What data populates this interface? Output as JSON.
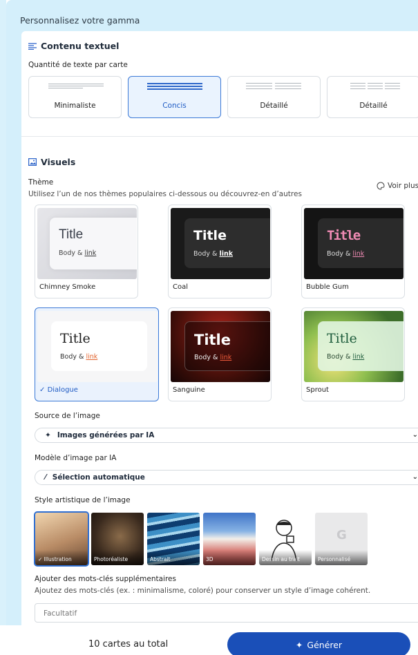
{
  "header": {
    "title": "Personnalisez votre gamma"
  },
  "text_section": {
    "title": "Contenu textuel",
    "quantity_label": "Quantité de texte par carte",
    "options": [
      {
        "label": "Minimaliste",
        "selected": false
      },
      {
        "label": "Concis",
        "selected": true
      },
      {
        "label": "Détaillé",
        "selected": false
      },
      {
        "label": "Détaillé",
        "selected": false
      }
    ]
  },
  "visuals": {
    "title": "Visuels",
    "theme_label": "Thème",
    "theme_help": "Utilisez l’un de nos thèmes populaires ci-dessous ou découvrez-en d’autres",
    "see_more": "Voir plus",
    "themes": [
      {
        "name": "Chimney Smoke",
        "title": "Title",
        "body": "Body & ",
        "link": "link"
      },
      {
        "name": "Coal",
        "title": "Title",
        "body": "Body & ",
        "link": "link"
      },
      {
        "name": "Bubble Gum",
        "title": "Title",
        "body": "Body & ",
        "link": "link"
      },
      {
        "name": "Dialogue",
        "title": "Title",
        "body": "Body & ",
        "link": "link",
        "selected": true
      },
      {
        "name": "Sanguine",
        "title": "Title",
        "body": "Body & ",
        "link": "link"
      },
      {
        "name": "Sprout",
        "title": "Title",
        "body": "Body & ",
        "link": "link"
      }
    ]
  },
  "image_source": {
    "label": "Source de l’image",
    "value": "Images générées par IA"
  },
  "image_model": {
    "label": "Modèle d’image par IA",
    "value": "Sélection automatique"
  },
  "art_style": {
    "label": "Style artistique de l’image",
    "styles": [
      {
        "name": "Illustration",
        "selected": true
      },
      {
        "name": "Photoréaliste"
      },
      {
        "name": "Abstrait"
      },
      {
        "name": "3D"
      },
      {
        "name": "Dessin au trait"
      },
      {
        "name": "Personnalisé"
      }
    ]
  },
  "keywords": {
    "label": "Ajouter des mots-clés supplémentaires",
    "help": "Ajoutez des mots-clés (ex. : minimalisme, coloré) pour conserver un style d’image cohérent.",
    "placeholder": "Facultatif"
  },
  "footer": {
    "total": "10 cartes au total",
    "generate": "Générer"
  },
  "colors": {
    "accent": "#1a4fb8",
    "selected_bg": "#eaf3fe",
    "panel_bg": "#d4effb"
  }
}
